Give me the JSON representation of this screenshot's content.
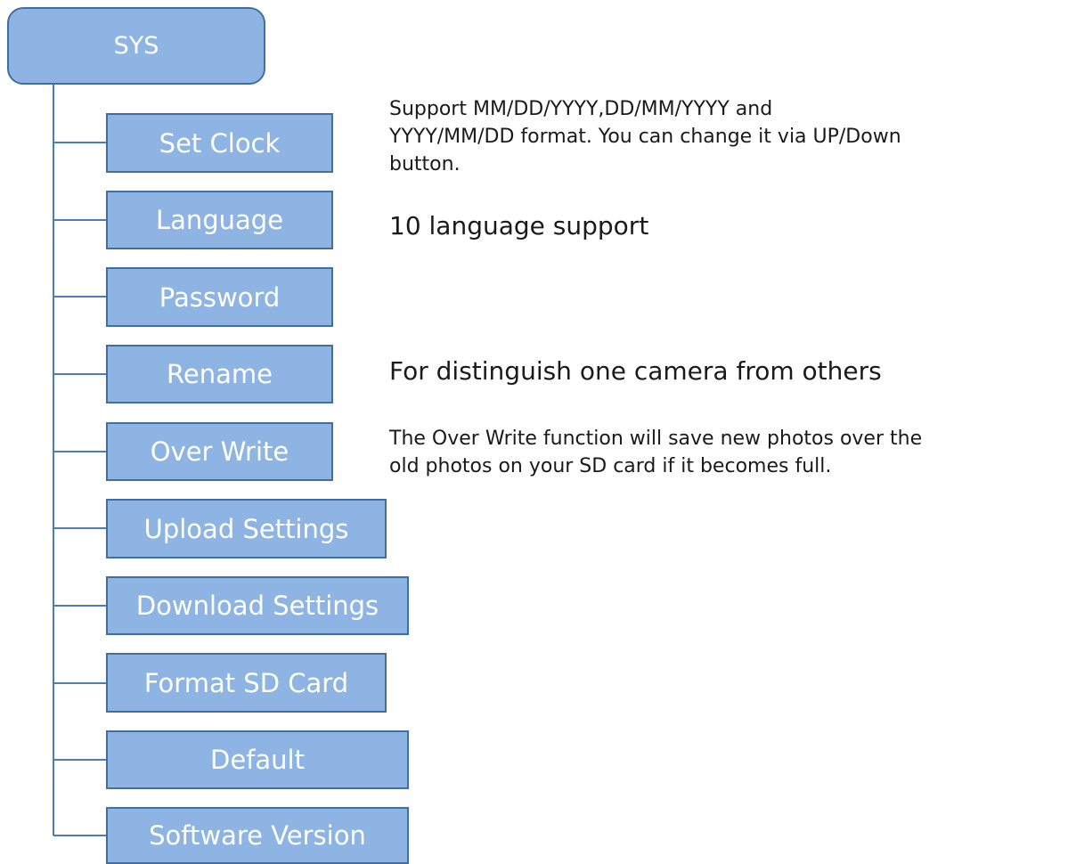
{
  "root": {
    "label": "SYS"
  },
  "items": [
    {
      "id": "set-clock",
      "label": "Set Clock"
    },
    {
      "id": "language",
      "label": "Language"
    },
    {
      "id": "password",
      "label": "Password"
    },
    {
      "id": "rename",
      "label": "Rename"
    },
    {
      "id": "over-write",
      "label": "Over Write"
    },
    {
      "id": "upload-settings",
      "label": "Upload Settings"
    },
    {
      "id": "download-settings",
      "label": "Download Settings"
    },
    {
      "id": "format-sd-card",
      "label": "Format SD Card"
    },
    {
      "id": "default",
      "label": "Default"
    },
    {
      "id": "software-version",
      "label": "Software Version"
    }
  ],
  "notes": {
    "set_clock": {
      "line1": "Support MM/DD/YYYY,DD/MM/YYYY and",
      "line2": "YYYY/MM/DD format. You can change it via UP/Down",
      "line3": "button."
    },
    "language": "10 language support",
    "rename": "For distinguish one camera from others",
    "over_write": {
      "line1": "The Over Write function will save new photos over the",
      "line2": "old photos on your SD card if it becomes full."
    }
  },
  "colors": {
    "box_fill": "#8eb4e3",
    "box_border": "#426fa3",
    "connector": "#4a7ebb",
    "box_text": "#ffffff",
    "note_text": "#1a1a1a"
  }
}
